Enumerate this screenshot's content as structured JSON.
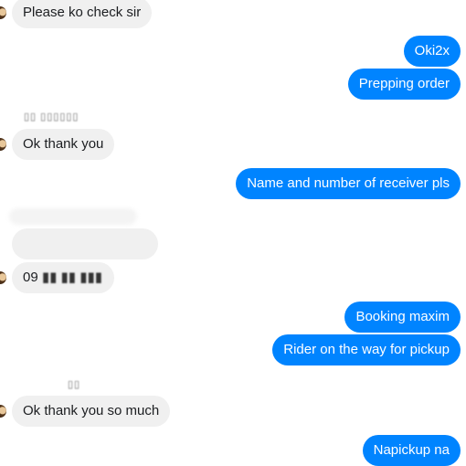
{
  "messages": [
    {
      "side": "in",
      "text": "Please ko check sir"
    },
    {
      "side": "out",
      "text": "Oki2x"
    },
    {
      "side": "out",
      "text": "Prepping order"
    },
    {
      "side": "in",
      "text": "Ok thank you"
    },
    {
      "side": "out",
      "text": "Name and number of receiver pls"
    },
    {
      "side": "in",
      "text": "09"
    },
    {
      "side": "out",
      "text": "Booking maxim"
    },
    {
      "side": "out",
      "text": "Rider on the way for pickup"
    },
    {
      "side": "in",
      "text": "Ok thank you so much"
    },
    {
      "side": "out",
      "text": "Napickup na"
    }
  ],
  "colors": {
    "outgoing_bubble": "#0084ff",
    "incoming_bubble": "#f0f0f0",
    "outgoing_text": "#ffffff",
    "incoming_text": "#1c1e21"
  },
  "icons": {
    "avatar": "contact-avatar"
  }
}
